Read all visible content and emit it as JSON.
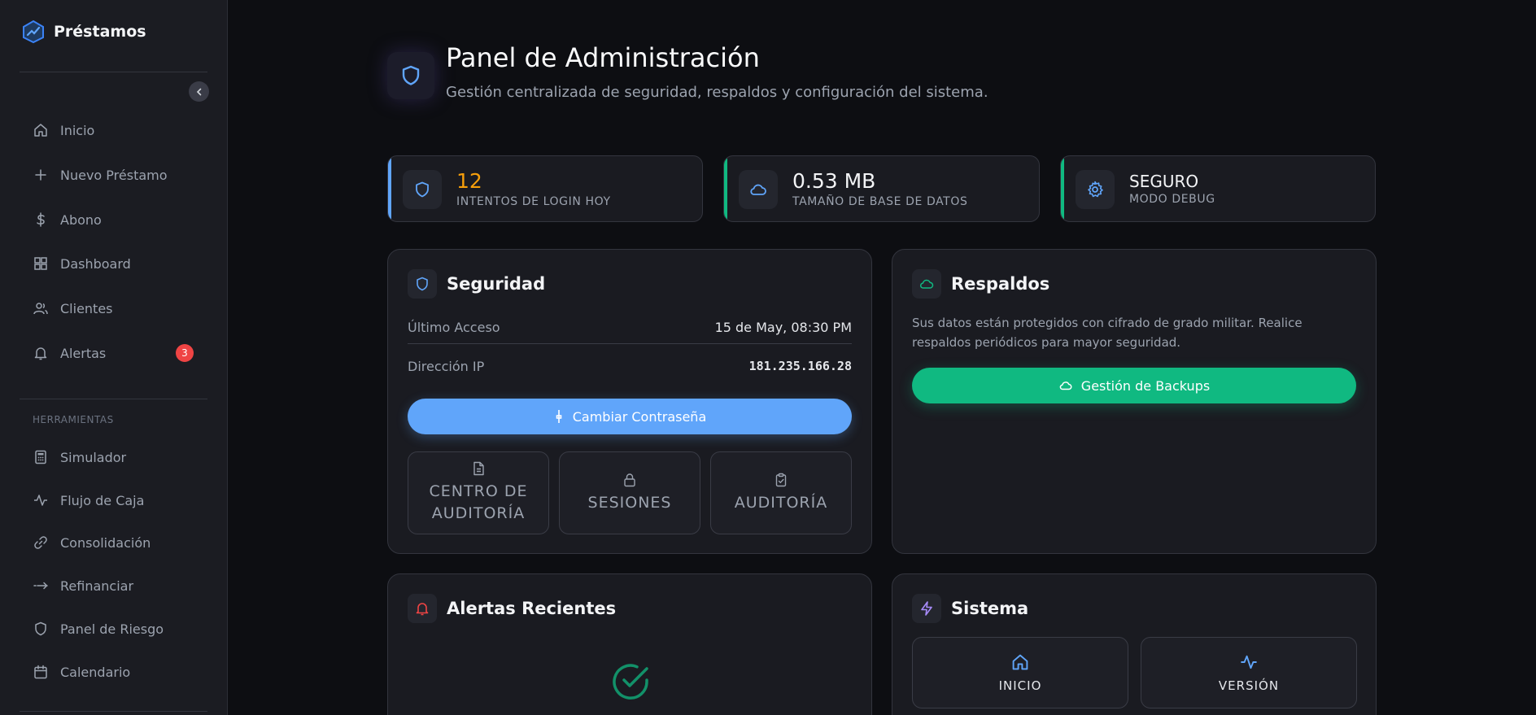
{
  "sidebar": {
    "brand": "Préstamos",
    "nav": [
      {
        "label": "Inicio",
        "icon": "home-icon"
      },
      {
        "label": "Nuevo Préstamo",
        "icon": "plus-icon"
      },
      {
        "label": "Abono",
        "icon": "dollar-icon"
      },
      {
        "label": "Dashboard",
        "icon": "grid-icon"
      },
      {
        "label": "Clientes",
        "icon": "users-icon"
      },
      {
        "label": "Alertas",
        "icon": "bell-icon",
        "badge": "3"
      }
    ],
    "tools_section": "HERRAMIENTAS",
    "tools": [
      {
        "label": "Simulador",
        "icon": "calculator-icon"
      },
      {
        "label": "Flujo de Caja",
        "icon": "activity-icon"
      },
      {
        "label": "Consolidación",
        "icon": "link-icon"
      },
      {
        "label": "Refinanciar",
        "icon": "arrow-right-icon"
      },
      {
        "label": "Panel de Riesgo",
        "icon": "shield-icon"
      },
      {
        "label": "Calendario",
        "icon": "calendar-icon"
      }
    ]
  },
  "header": {
    "title": "Panel de Administración",
    "subtitle": "Gestión centralizada de seguridad, respaldos y configuración del sistema."
  },
  "stats": [
    {
      "value": "12",
      "label": "INTENTOS DE LOGIN HOY",
      "accent": "#60a5fa",
      "value_color": "#f59e0b",
      "icon": "shield-icon"
    },
    {
      "value": "0.53 MB",
      "label": "TAMAÑO DE BASE DE DATOS",
      "accent": "#10b981",
      "value_color": "#f3f4f6",
      "icon": "cloud-icon"
    },
    {
      "value": "SEGURO",
      "label": "MODO DEBUG",
      "accent": "#10b981",
      "value_color": "#f3f4f6",
      "icon": "gear-icon"
    }
  ],
  "security": {
    "title": "Seguridad",
    "last_access_label": "Último Acceso",
    "last_access_value": "15 de May, 08:30 PM",
    "ip_label": "Dirección IP",
    "ip_value": "181.235.166.28",
    "change_password": "Cambiar Contraseña",
    "tiles": [
      "CENTRO DE AUDITORÍA",
      "SESIONES",
      "AUDITORÍA"
    ]
  },
  "backups": {
    "title": "Respaldos",
    "description": "Sus datos están protegidos con cifrado de grado militar. Realice respaldos periódicos para mayor seguridad.",
    "button": "Gestión de Backups"
  },
  "alerts": {
    "title": "Alertas Recientes"
  },
  "system": {
    "title": "Sistema",
    "tiles": [
      "INICIO",
      "VERSIÓN"
    ]
  },
  "colors": {
    "blue": "#60a5fa",
    "green": "#10b981",
    "red": "#ef4444",
    "amber": "#f59e0b",
    "purple": "#a78bfa"
  }
}
